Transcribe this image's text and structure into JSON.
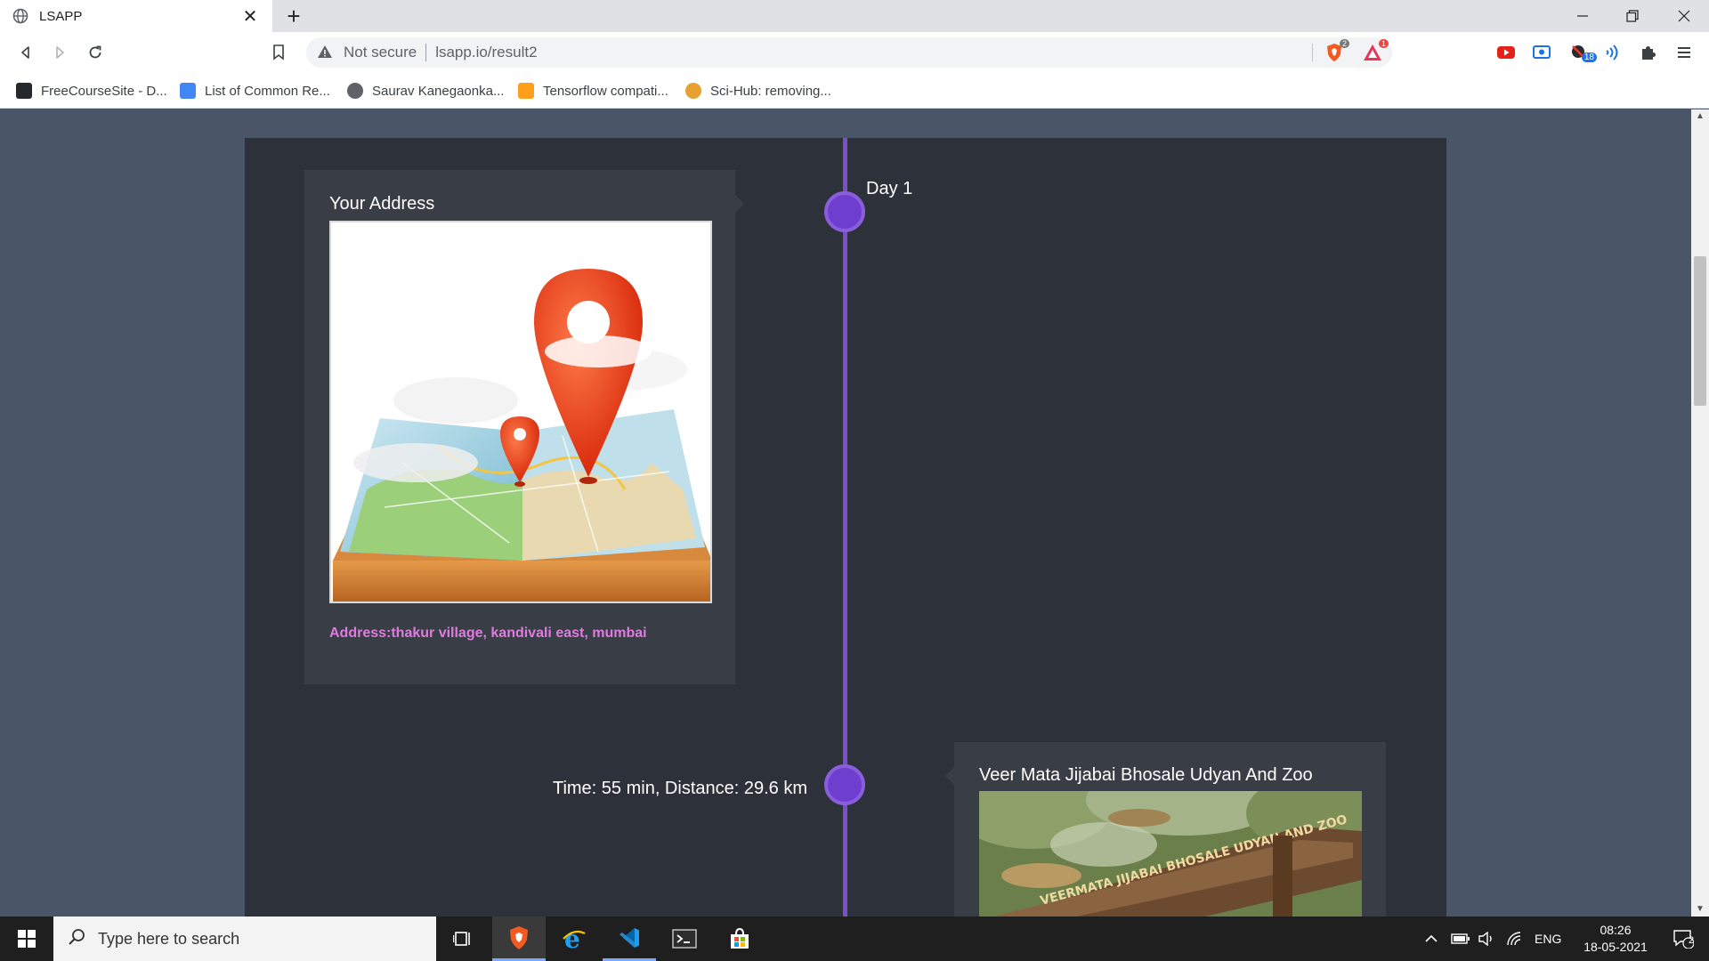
{
  "browser": {
    "tab_title": "LSAPP",
    "tab_close": "✕",
    "new_tab": "+",
    "security_text": "Not secure",
    "url": "lsapp.io/result2",
    "shield_count": "2",
    "rewards_count": "1",
    "ext_badge": "18"
  },
  "bookmarks": [
    {
      "label": "FreeCourseSite - D..."
    },
    {
      "label": "List of Common Re..."
    },
    {
      "label": "Saurav Kanegaonka..."
    },
    {
      "label": "Tensorflow compati..."
    },
    {
      "label": "Sci-Hub: removing..."
    }
  ],
  "timeline": {
    "day_label": "Day 1",
    "start_card": {
      "title": "Your Address",
      "address": "Address:thakur village, kandivali east, mumbai"
    },
    "leg_1": {
      "travel": "Time: 55 min, Distance: 29.6 km"
    },
    "stop_1": {
      "title": "Veer Mata Jijabai Bhosale Udyan And Zoo",
      "sign_text": "VEERMATA JIJABAI BHOSALE UDYAN AND ZOO"
    }
  },
  "taskbar": {
    "search_placeholder": "Type here to search",
    "language": "ENG",
    "time": "08:26",
    "date": "18-05-2021",
    "notification_count": "2"
  },
  "colors": {
    "timeline_accent": "#7b4fc9",
    "address_text": "#e07be0",
    "page_bg": "#4a5568",
    "container_bg": "#2d3139",
    "card_bg": "#383d46"
  }
}
